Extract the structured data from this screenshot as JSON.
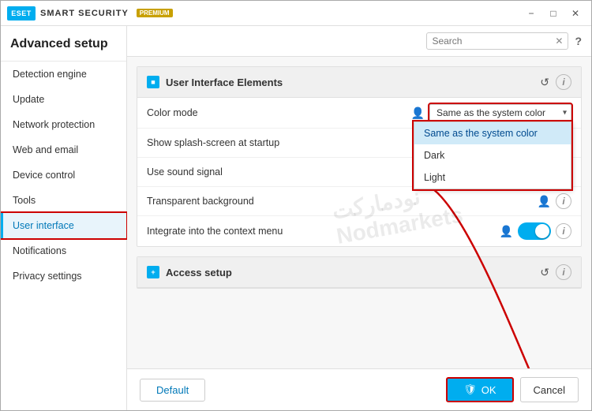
{
  "titlebar": {
    "logo_text": "ESET",
    "app_name": "SMART SECURITY",
    "badge": "PREMIUM",
    "minimize_label": "−",
    "maximize_label": "□",
    "close_label": "✕",
    "help_label": "?"
  },
  "sidebar": {
    "header": "Advanced setup",
    "items": [
      {
        "id": "detection-engine",
        "label": "Detection engine",
        "active": false
      },
      {
        "id": "update",
        "label": "Update",
        "active": false
      },
      {
        "id": "network-protection",
        "label": "Network protection",
        "active": false
      },
      {
        "id": "web-and-email",
        "label": "Web and email",
        "active": false
      },
      {
        "id": "device-control",
        "label": "Device control",
        "active": false
      },
      {
        "id": "tools",
        "label": "Tools",
        "active": false
      },
      {
        "id": "user-interface",
        "label": "User interface",
        "active": true
      },
      {
        "id": "notifications",
        "label": "Notifications",
        "active": false
      },
      {
        "id": "privacy-settings",
        "label": "Privacy settings",
        "active": false
      }
    ]
  },
  "search": {
    "placeholder": "Search"
  },
  "section1": {
    "title": "User Interface Elements",
    "icon": "■",
    "reset_label": "↺",
    "info_label": "i"
  },
  "settings": {
    "rows": [
      {
        "label": "Color mode",
        "has_person": true,
        "has_info": false,
        "control_type": "dropdown",
        "value": "Same as the system color"
      },
      {
        "label": "Show splash-screen at startup",
        "has_person": true,
        "has_info": true,
        "control_type": "none",
        "value": ""
      },
      {
        "label": "Use sound signal",
        "has_person": true,
        "has_info": true,
        "control_type": "none",
        "value": ""
      },
      {
        "label": "Transparent background",
        "has_person": true,
        "has_info": true,
        "control_type": "none",
        "value": ""
      },
      {
        "label": "Integrate into the context menu",
        "has_person": true,
        "has_info": true,
        "control_type": "toggle",
        "value": "on"
      }
    ]
  },
  "dropdown_options": [
    {
      "label": "Same as the system color",
      "selected": true
    },
    {
      "label": "Dark",
      "selected": false
    },
    {
      "label": "Light",
      "selected": false
    }
  ],
  "section2": {
    "title": "Access setup",
    "icon": "+",
    "reset_label": "↺",
    "info_label": "i"
  },
  "bottom": {
    "default_label": "Default",
    "ok_icon": "🛡",
    "ok_label": "OK",
    "cancel_label": "Cancel"
  },
  "watermark": "نودمارکت\nNodmarkets"
}
